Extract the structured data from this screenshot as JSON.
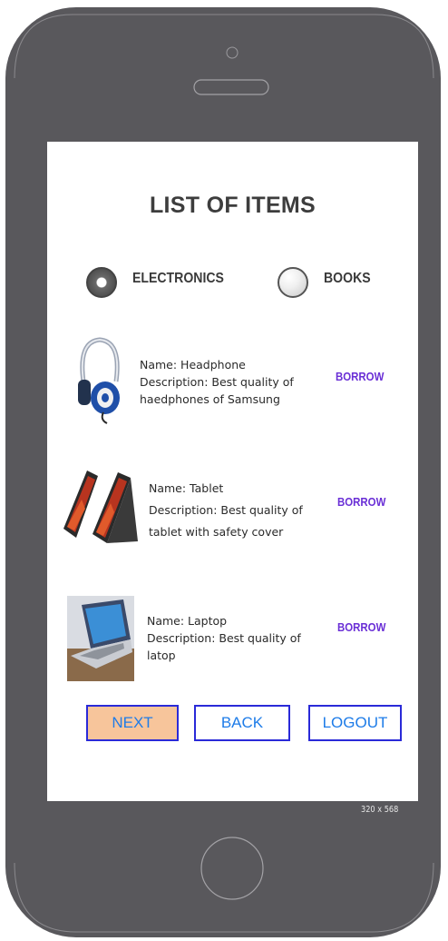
{
  "screen": {
    "title": "LIST OF ITEMS"
  },
  "categories": {
    "options": [
      {
        "label": "ELECTRONICS",
        "selected": true
      },
      {
        "label": "BOOKS",
        "selected": false
      }
    ]
  },
  "items": [
    {
      "name": "Name: Headphone",
      "description_lines": [
        "Description: Best quality of",
        "haedphones of Samsung"
      ],
      "action_label": "BORROW",
      "image_icon": "headphone-image"
    },
    {
      "name": "Name: Tablet",
      "description_lines": [
        "Description: Best quality of",
        "tablet with safety cover"
      ],
      "action_label": "BORROW",
      "image_icon": "tablet-image"
    },
    {
      "name": "Name: Laptop",
      "description_lines": [
        "Description: Best quality of",
        "latop"
      ],
      "action_label": "BORROW",
      "image_icon": "laptop-image"
    }
  ],
  "buttons": {
    "next_label": "NEXT",
    "back_label": "BACK",
    "logout_label": "LOGOUT"
  },
  "device": {
    "size_label": "320 x 568"
  },
  "colors": {
    "phone_body": "#59585c",
    "accent_link": "#6a2fd6",
    "button_border": "#2a2ad8",
    "button_text": "#1e7ce8",
    "next_background": "#f7c59b"
  }
}
